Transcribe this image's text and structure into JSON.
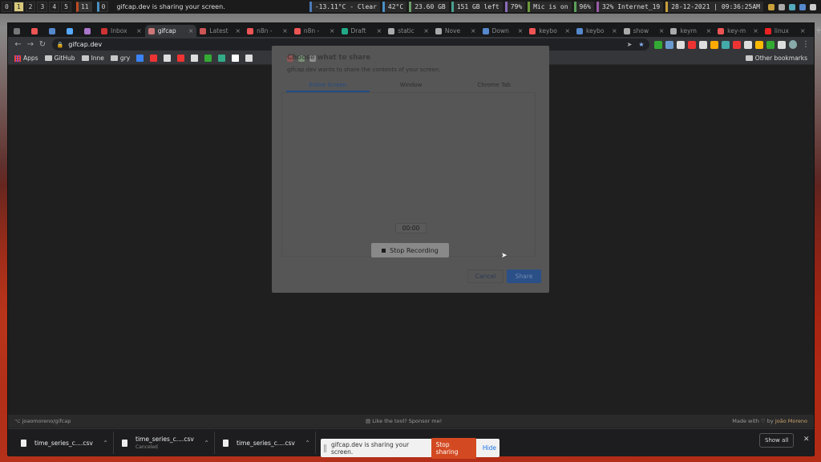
{
  "topbar": {
    "workspaces": [
      "0",
      "1",
      "2",
      "3",
      "4",
      "5"
    ],
    "extra_workspaces": [
      "11",
      "0"
    ],
    "window_title": "gifcap.dev is sharing your screen.",
    "status": [
      {
        "text": "-13.11°C - Clear",
        "color": "#4a7ab8"
      },
      {
        "text": "42°C",
        "color": "#4a90c2"
      },
      {
        "text": "23.60 GB",
        "color": "#6a9a6a"
      },
      {
        "text": "151 GB left",
        "color": "#4aa090"
      },
      {
        "text": "79%",
        "color": "#8a6ab8"
      },
      {
        "text": "Mic is on",
        "color": "#6a9a3a"
      },
      {
        "text": "96%",
        "color": "#5aa05a"
      },
      {
        "text": "32% Internet_19",
        "color": "#9a5aa8"
      },
      {
        "text": "28-12-2021 | 09:36:25AM",
        "color": "#c8a03a"
      }
    ]
  },
  "browser": {
    "tabs": [
      {
        "label": "Inbox",
        "color": "#c33"
      },
      {
        "label": "gifcap",
        "color": "#c77",
        "active": true
      },
      {
        "label": "Latest",
        "color": "#c55"
      },
      {
        "label": "n8n -",
        "color": "#e55"
      },
      {
        "label": "n8n -",
        "color": "#e55"
      },
      {
        "label": "Draft",
        "color": "#2a8"
      },
      {
        "label": "static",
        "color": "#aaa"
      },
      {
        "label": "Nove",
        "color": "#aaa"
      },
      {
        "label": "Down",
        "color": "#58c"
      },
      {
        "label": "keybo",
        "color": "#e55"
      },
      {
        "label": "keybo",
        "color": "#58c"
      },
      {
        "label": "show",
        "color": "#aaa"
      },
      {
        "label": "keym",
        "color": "#aaa"
      },
      {
        "label": "key-m",
        "color": "#e55"
      },
      {
        "label": "linux",
        "color": "#e22"
      }
    ],
    "address": "gifcap.dev",
    "bookmarks": [
      {
        "label": "Apps",
        "kind": "apps"
      },
      {
        "label": "GitHub",
        "kind": "folder"
      },
      {
        "label": "Inne",
        "kind": "folder"
      },
      {
        "label": "gry",
        "kind": "folder"
      }
    ],
    "bookmark_icon_colors": [
      "#3b82f6",
      "#e33",
      "#ddd",
      "#e33",
      "#ddd",
      "#3a3",
      "#3a8",
      "#fff",
      "#ddd"
    ],
    "other_bookmarks": "Other bookmarks",
    "extension_colors": [
      "#3a3",
      "#6a9ad0",
      "#ddd",
      "#e33",
      "#ddd",
      "#fa0",
      "#4aa",
      "#e33",
      "#ddd",
      "#fb0",
      "#3a3",
      "#ddd"
    ]
  },
  "dialog": {
    "title": "Choose what to share",
    "subtitle": "gifcap.dev wants to share the contents of your screen.",
    "tabs": [
      "Entire Screen",
      "Window",
      "Chrome Tab"
    ],
    "cancel": "Cancel",
    "share": "Share"
  },
  "recorder": {
    "timer": "00:00",
    "stop_label": "Stop Recording"
  },
  "footer": {
    "repo": "joaomoreno/gifcap",
    "sponsor": "Like the tool? Sponsor me!",
    "made_with": "Made with",
    "by": "by",
    "author": "João Moreno"
  },
  "downloads": [
    {
      "name": "time_series_c....csv",
      "sub": ""
    },
    {
      "name": "time_series_c....csv",
      "sub": "Canceled"
    },
    {
      "name": "time_series_c....csv",
      "sub": ""
    }
  ],
  "shelf": {
    "show_all": "Show all"
  },
  "sharebar": {
    "message": "gifcap.dev is sharing your screen.",
    "stop": "Stop sharing",
    "hide": "Hide"
  }
}
